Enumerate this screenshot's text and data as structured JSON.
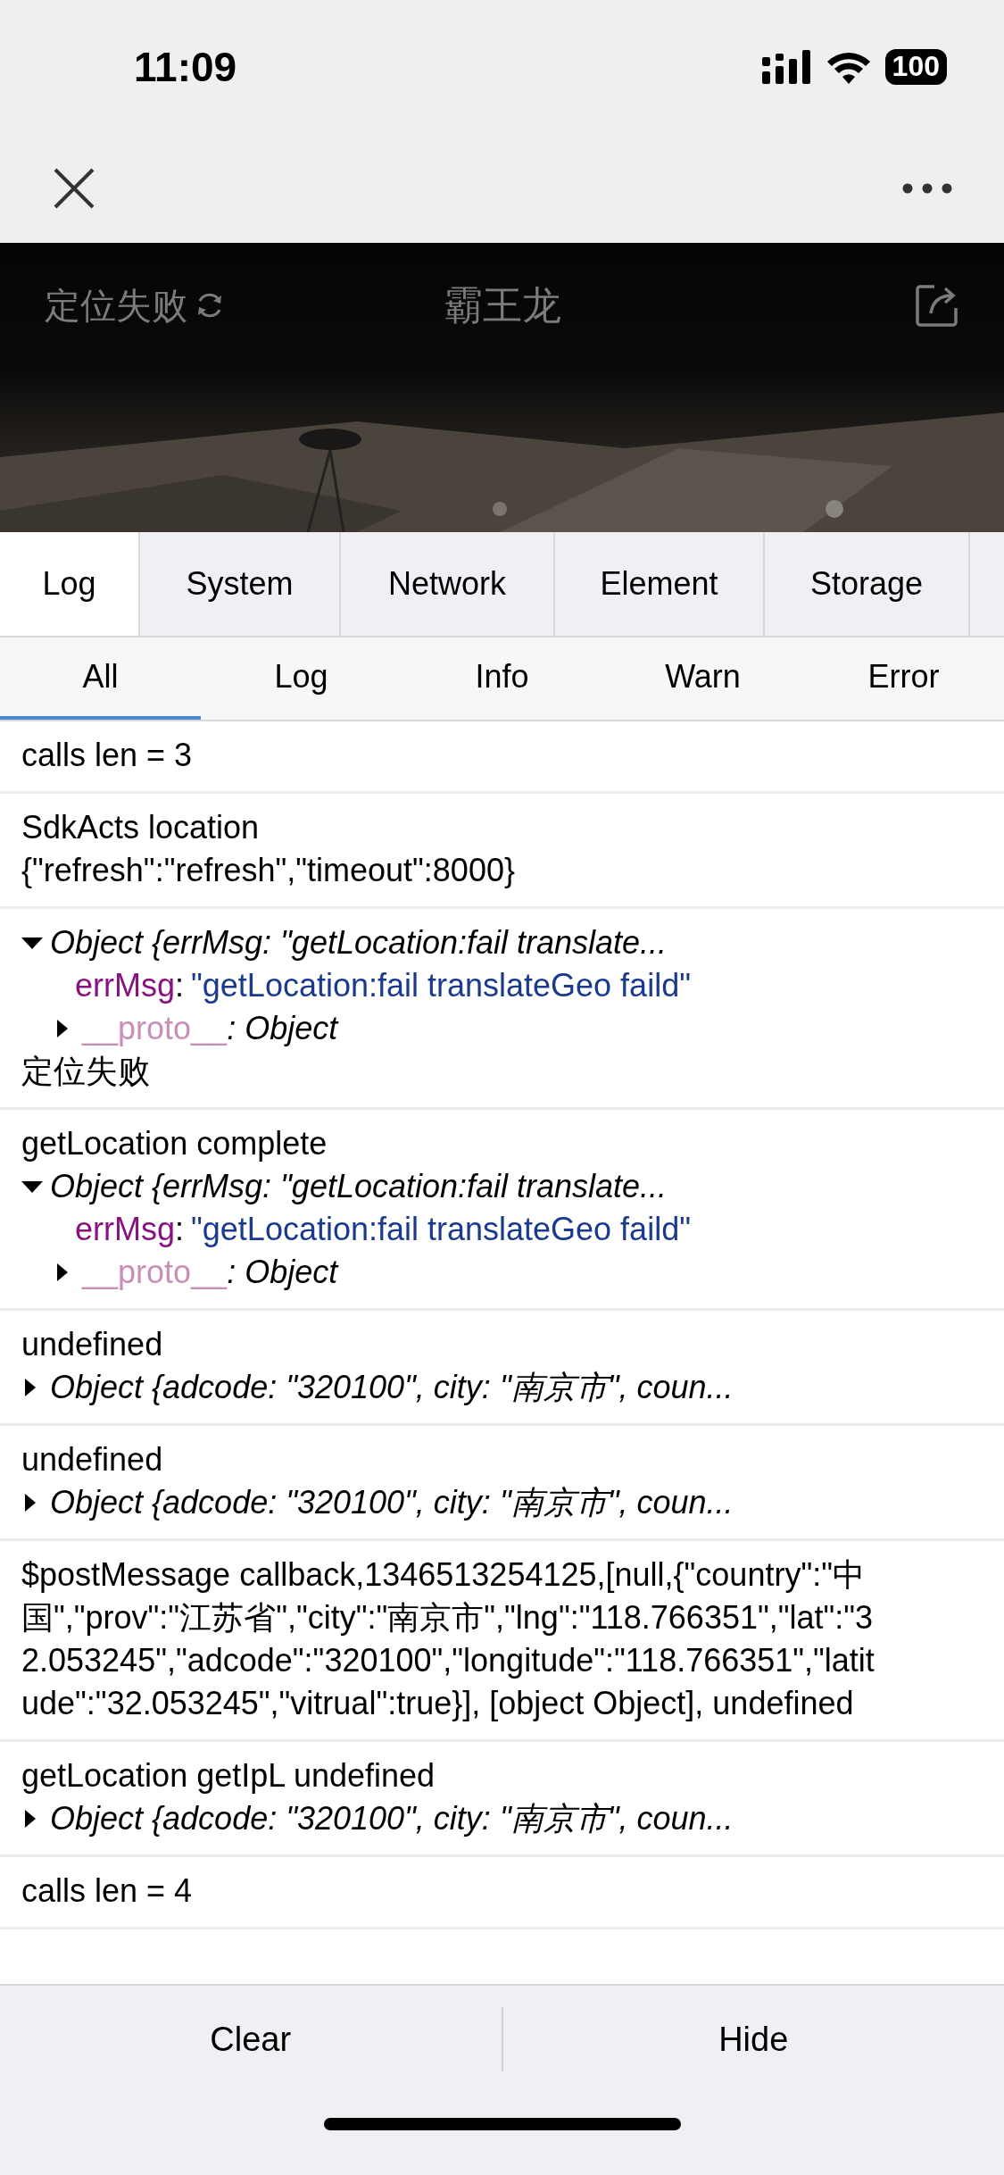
{
  "status_bar": {
    "time": "11:09",
    "battery": "100"
  },
  "page_header": {
    "location_status": "定位失败",
    "title": "霸王龙"
  },
  "tabs": [
    {
      "label": "Log",
      "selected": true
    },
    {
      "label": "System",
      "selected": false
    },
    {
      "label": "Network",
      "selected": false
    },
    {
      "label": "Element",
      "selected": false
    },
    {
      "label": "Storage",
      "selected": false
    }
  ],
  "filters": [
    {
      "label": "All",
      "selected": true
    },
    {
      "label": "Log",
      "selected": false
    },
    {
      "label": "Info",
      "selected": false
    },
    {
      "label": "Warn",
      "selected": false
    },
    {
      "label": "Error",
      "selected": false
    }
  ],
  "entries": [
    {
      "lines": [
        {
          "kind": "text",
          "text": "calls len = 3"
        }
      ]
    },
    {
      "lines": [
        {
          "kind": "text",
          "text": "SdkActs location"
        },
        {
          "kind": "text",
          "text": "{\"refresh\":\"refresh\",\"timeout\":8000}"
        }
      ]
    },
    {
      "lines": [
        {
          "kind": "object",
          "expanded": true,
          "summary": "Object {errMsg: \"getLocation:fail translate..."
        },
        {
          "kind": "property",
          "key": "errMsg",
          "separator": ":",
          "value": "\"getLocation:fail translateGeo faild\""
        },
        {
          "kind": "proto",
          "expanded": false,
          "key": "__proto__",
          "value": ": Object"
        },
        {
          "kind": "text",
          "text": "定位失败"
        }
      ]
    },
    {
      "lines": [
        {
          "kind": "text",
          "text": "getLocation complete"
        },
        {
          "kind": "object",
          "expanded": true,
          "summary": "Object {errMsg: \"getLocation:fail translate..."
        },
        {
          "kind": "property",
          "key": "errMsg",
          "separator": ":",
          "value": "\"getLocation:fail translateGeo faild\""
        },
        {
          "kind": "proto",
          "expanded": false,
          "key": "__proto__",
          "value": ": Object"
        }
      ]
    },
    {
      "lines": [
        {
          "kind": "text",
          "text": "undefined"
        },
        {
          "kind": "object",
          "expanded": false,
          "summary": "Object {adcode: \"320100\", city: \"南京市\", coun..."
        }
      ]
    },
    {
      "lines": [
        {
          "kind": "text",
          "text": "undefined"
        },
        {
          "kind": "object",
          "expanded": false,
          "summary": "Object {adcode: \"320100\", city: \"南京市\", coun..."
        }
      ]
    },
    {
      "lines": [
        {
          "kind": "text",
          "text": "$postMessage callback,1346513254125,[null,{\"country\":\"中国\",\"prov\":\"江苏省\",\"city\":\"南京市\",\"lng\":\"118.766351\",\"lat\":\"32.053245\",\"adcode\":\"320100\",\"longitude\":\"118.766351\",\"latitude\":\"32.053245\",\"vitrual\":true}], [object Object], undefined"
        }
      ]
    },
    {
      "lines": [
        {
          "kind": "text",
          "text": "getLocation getIpL undefined"
        },
        {
          "kind": "object",
          "expanded": false,
          "summary": "Object {adcode: \"320100\", city: \"南京市\", coun..."
        }
      ]
    },
    {
      "lines": [
        {
          "kind": "text",
          "text": "calls len = 4"
        }
      ]
    }
  ],
  "footer": {
    "buttons": [
      "Clear",
      "Hide"
    ]
  }
}
